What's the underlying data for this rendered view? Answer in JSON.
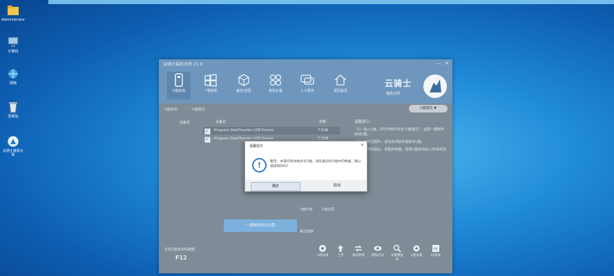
{
  "desktop": {
    "icons": [
      {
        "name": "folder",
        "label": "Administrator"
      },
      {
        "name": "computer",
        "label": "计算机"
      },
      {
        "name": "network",
        "label": "网络"
      },
      {
        "name": "recycle-bin",
        "label": "回收站"
      },
      {
        "name": "app",
        "label": "云骑士装机大师"
      }
    ]
  },
  "window": {
    "title": "云骑士装机大师 V1.0",
    "controls": {
      "minimize": "—",
      "close": "✕"
    },
    "toolbar": [
      {
        "name": "usb-boot",
        "label": "U盘启动",
        "active": true
      },
      {
        "name": "system-reinstall",
        "label": "一键装机",
        "active": false
      },
      {
        "name": "backup-restore",
        "label": "备份/还原",
        "active": false
      },
      {
        "name": "software",
        "label": "装机必备",
        "active": false
      },
      {
        "name": "support",
        "label": "人工服务",
        "active": false
      },
      {
        "name": "home",
        "label": "返回首页",
        "active": false
      }
    ],
    "brand": {
      "name": "云骑士",
      "sub": "装机大师"
    },
    "breadcrumb": {
      "items": [
        "U盘启动",
        "U盘模式"
      ],
      "back": "U盘模式 ▼"
    },
    "device_label": "设备名",
    "devices_header": {
      "col1": "设备名",
      "col2": "容量"
    },
    "devices": [
      {
        "name": "Kingston DataTraveler USB Device",
        "size": "7.5GB"
      },
      {
        "name": "Kingston DataTraveler USB Device",
        "size": "7.5GB"
      }
    ],
    "side_panel": {
      "title": "温馨提示：",
      "paragraphs": [
        "（1）插入U盘，并打开软件点击\"U盘模式\"，选择一键制作启动U盘。",
        "（2）制作过程中，请勿关闭软件或拔出U盘。",
        "（3）制作完成后，请重启电脑，选择U盘启动进入PE系统进行安装。"
      ]
    },
    "make_button": "一键制作启动U盘",
    "links": {
      "upgrade": "U盘升级",
      "restore": "U盘还原",
      "format": "格式转换"
    },
    "hotkey_prompt": "本机U盘启动快捷键：",
    "hotkey": "F12",
    "footer_tools": [
      {
        "name": "upgrade",
        "label": "U盘升级"
      },
      {
        "name": "upload",
        "label": "上传"
      },
      {
        "name": "convert",
        "label": "格式转换"
      },
      {
        "name": "simulate",
        "label": "模拟启动"
      },
      {
        "name": "search",
        "label": "快捷键查询"
      },
      {
        "name": "settings",
        "label": "U盘设置"
      },
      {
        "name": "pe",
        "label": "PE版本"
      }
    ]
  },
  "dialog": {
    "title": "温馨提示",
    "close": "✕",
    "message": "警告：本操作将会格式化U盘，请先备份好U盘中的数据，确认继续制作吗？",
    "confirm": "确定",
    "cancel": "取消"
  }
}
